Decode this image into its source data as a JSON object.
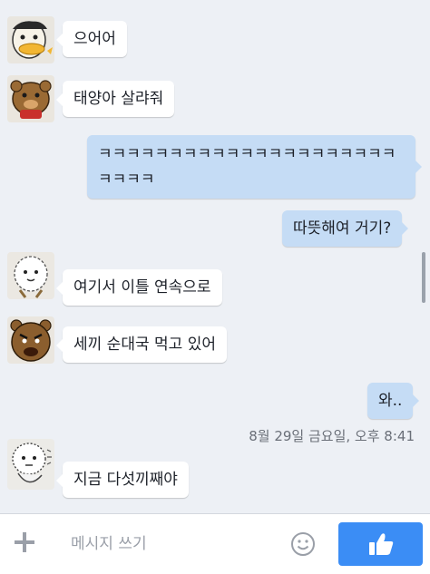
{
  "messages": [
    {
      "direction": "incoming",
      "text": "으어어",
      "avatar": "white-duck-sticker-avatar"
    },
    {
      "direction": "incoming",
      "text": "태양아 살랴줘",
      "avatar": "brown-bear-sticker-avatar"
    },
    {
      "direction": "outgoing",
      "text": "ㅋㅋㅋㅋㅋㅋㅋㅋㅋㅋㅋㅋㅋㅋㅋㅋㅋㅋㅋㅋㅋㅋㅋㅋㅋ"
    },
    {
      "direction": "outgoing",
      "text": "따뜻해여 거기?"
    },
    {
      "direction": "incoming",
      "text": "여기서 이틀 연속으로",
      "avatar": "white-fluffy-sticker-avatar"
    },
    {
      "direction": "incoming",
      "text": "세끼 순대국 먹고 있어",
      "avatar": "angry-bear-sticker-avatar"
    },
    {
      "direction": "outgoing",
      "text": "와.."
    },
    {
      "direction": "incoming",
      "text": "지금 다섯끼째야",
      "avatar": "shivering-fluffy-sticker-avatar"
    }
  ],
  "timestamp": "8월 29일 금요일, 오후 8:41",
  "composer": {
    "placeholder": "메시지 쓰기",
    "plus_icon": "plus-icon",
    "emoji_icon": "smiley-icon",
    "send_icon": "thumbs-up-icon"
  },
  "colors": {
    "background": "#edf0f5",
    "incoming_bubble": "#ffffff",
    "outgoing_bubble": "#c5dcf5",
    "like_button": "#3b8df5"
  }
}
